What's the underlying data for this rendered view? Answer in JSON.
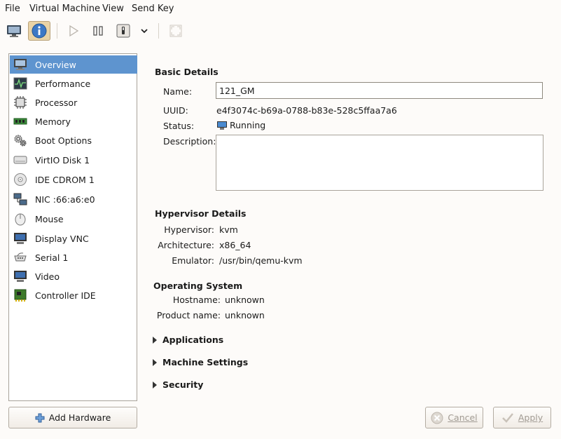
{
  "menu": {
    "file": "File",
    "virtual_machine": "Virtual Machine",
    "view": "View",
    "send_key": "Send Key"
  },
  "toolbar": {
    "console": "console-icon",
    "details": "info-icon",
    "run": "play-icon",
    "pause": "pause-icon",
    "shutdown": "power-icon",
    "shutdown_menu": "chevron-down-icon",
    "fullscreen": "fullscreen-icon"
  },
  "sidebar": {
    "items": [
      {
        "label": "Overview",
        "icon": "monitor-icon"
      },
      {
        "label": "Performance",
        "icon": "performance-icon"
      },
      {
        "label": "Processor",
        "icon": "cpu-icon"
      },
      {
        "label": "Memory",
        "icon": "memory-icon"
      },
      {
        "label": "Boot Options",
        "icon": "gears-icon"
      },
      {
        "label": "VirtIO Disk 1",
        "icon": "disk-icon"
      },
      {
        "label": "IDE CDROM 1",
        "icon": "cdrom-icon"
      },
      {
        "label": "NIC :66:a6:e0",
        "icon": "network-icon"
      },
      {
        "label": "Mouse",
        "icon": "mouse-icon"
      },
      {
        "label": "Display VNC",
        "icon": "display-icon"
      },
      {
        "label": "Serial 1",
        "icon": "serial-icon"
      },
      {
        "label": "Video",
        "icon": "video-icon"
      },
      {
        "label": "Controller IDE",
        "icon": "controller-icon"
      }
    ],
    "add_hardware": "Add Hardware"
  },
  "basic": {
    "title": "Basic Details",
    "name_label": "Name:",
    "name_value": "121_GM",
    "uuid_label": "UUID:",
    "uuid_value": "e4f3074c-b69a-0788-b83e-528c5ffaa7a6",
    "status_label": "Status:",
    "status_value": "Running",
    "description_label": "Description:",
    "description_value": ""
  },
  "hypervisor": {
    "title": "Hypervisor Details",
    "hypervisor_label": "Hypervisor:",
    "hypervisor_value": "kvm",
    "arch_label": "Architecture:",
    "arch_value": "x86_64",
    "emulator_label": "Emulator:",
    "emulator_value": "/usr/bin/qemu-kvm"
  },
  "os": {
    "title": "Operating System",
    "hostname_label": "Hostname:",
    "hostname_value": "unknown",
    "product_label": "Product name:",
    "product_value": "unknown"
  },
  "expanders": {
    "applications": "Applications",
    "machine_settings": "Machine Settings",
    "security": "Security"
  },
  "buttons": {
    "cancel": "Cancel",
    "apply": "Apply"
  },
  "colors": {
    "selection": "#5e94cf",
    "window_bg": "#fdfbf9"
  }
}
